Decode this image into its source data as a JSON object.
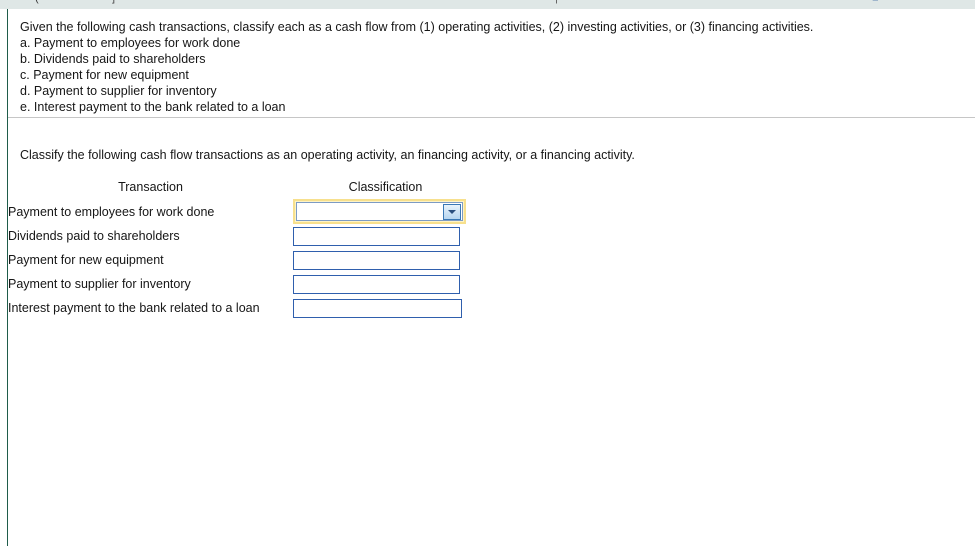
{
  "top_strip": {
    "background": "#dfe7e6",
    "clipped_glyphs": [
      "(",
      "]",
      "|",
      "■"
    ]
  },
  "question": {
    "prompt": "Given the following cash transactions, classify each as a cash flow from (1) operating activities, (2) investing activities, or (3) financing activities.",
    "items": [
      "a. Payment to employees for work done",
      "b. Dividends paid to shareholders",
      "c. Payment for new equipment",
      "d. Payment to supplier for inventory",
      "e. Interest payment to the bank related to a loan"
    ]
  },
  "answer": {
    "instruction": "Classify the following cash flow transactions as an operating activity, an financing activity, or a financing activity.",
    "columns": {
      "transaction": "Transaction",
      "classification": "Classification"
    },
    "rows": [
      {
        "transaction": "Payment to employees for work done",
        "classification_value": "",
        "control": "select"
      },
      {
        "transaction": "Dividends paid to shareholders",
        "classification_value": "",
        "control": "input"
      },
      {
        "transaction": "Payment for new equipment",
        "classification_value": "",
        "control": "input"
      },
      {
        "transaction": "Payment to supplier for inventory",
        "classification_value": "",
        "control": "input"
      },
      {
        "transaction": "Interest payment to the bank related to a loan",
        "classification_value": "",
        "control": "input"
      }
    ],
    "active_row_index": 0,
    "dropdown_icon": "chevron-down-icon"
  },
  "colors": {
    "left_rule": "#1f5c4a",
    "divider": "#c6c6c6",
    "input_border": "#2f5fad",
    "focus_ring": "#f7e08d",
    "dropdown_button_border": "#3a78b5",
    "text": "#161616"
  }
}
